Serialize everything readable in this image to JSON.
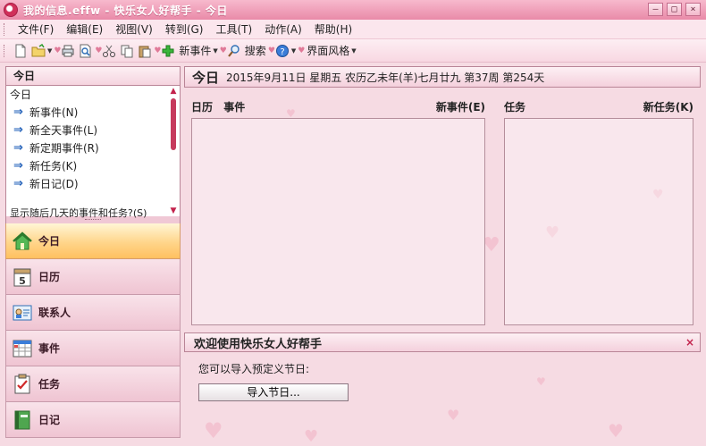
{
  "window": {
    "title": "我的信息.effw - 快乐女人好帮手 - 今日",
    "controls": {
      "minimize": "–",
      "maximize": "□",
      "close": "×"
    }
  },
  "menu": [
    "文件(F)",
    "编辑(E)",
    "视图(V)",
    "转到(G)",
    "工具(T)",
    "动作(A)",
    "帮助(H)"
  ],
  "toolbar": {
    "new_event_label": "新事件",
    "search_label": "搜索",
    "skin_label": "界面风格"
  },
  "left": {
    "header": "今日",
    "list_title": "今日",
    "items": [
      "新事件(N)",
      "新全天事件(L)",
      "新定期事件(R)",
      "新任务(K)",
      "新日记(D)"
    ],
    "cut_item": "显示随后几天的事件和任务?(S)"
  },
  "nav": [
    "今日",
    "日历",
    "联系人",
    "事件",
    "任务",
    "日记"
  ],
  "calendar_icon_day": "5",
  "today": {
    "title": "今日",
    "date": "2015年9月11日  星期五  农历乙未年(羊)七月廿九  第37周  第254天"
  },
  "events_pane": {
    "col1": "日历",
    "col2": "事件",
    "action": "新事件(E)"
  },
  "tasks_pane": {
    "col1": "任务",
    "action": "新任务(K)"
  },
  "welcome": {
    "title": "欢迎使用快乐女人好帮手",
    "close": "×",
    "text": "您可以导入预定义节日:",
    "button": "导入节日..."
  },
  "colors": {
    "accent": "#c3224c",
    "background": "#f6dbe3",
    "active_nav": "#ffd58a"
  }
}
